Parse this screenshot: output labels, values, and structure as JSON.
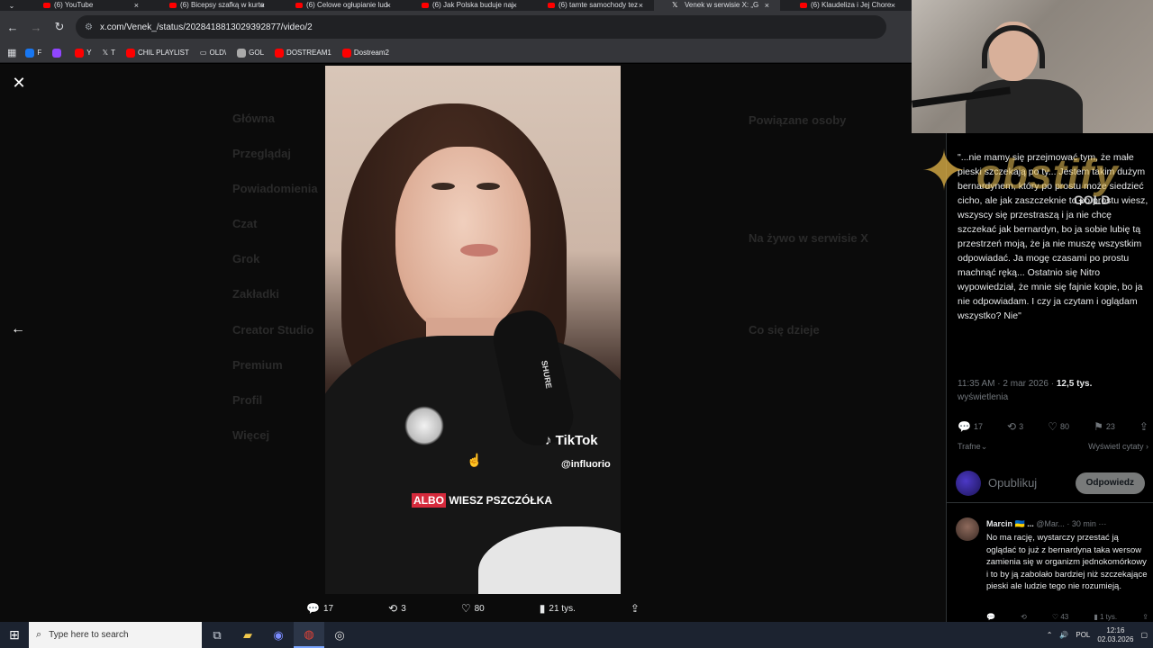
{
  "browser": {
    "tabs": [
      {
        "title": "(6) YouTube",
        "favicon": "youtube-icon"
      },
      {
        "title": "(6) Bicepsy szafką w kurto",
        "favicon": "youtube-icon"
      },
      {
        "title": "(6) Celowe ogłupianie lud",
        "favicon": "youtube-icon"
      },
      {
        "title": "(6) Jak Polska buduje naj",
        "favicon": "youtube-icon"
      },
      {
        "title": "(6) tamte samochody tez",
        "favicon": "youtube-icon"
      },
      {
        "title": "Venek w serwisie X: „G",
        "favicon": "x-icon"
      },
      {
        "title": "(6) Klaudeliza i Jej Chore",
        "favicon": "youtube-icon"
      }
    ],
    "url": "x.com/Venek_/status/2028418813029392877/video/2",
    "bookmarks": [
      "F",
      "",
      "Y",
      "T",
      "CHIL PLAYLIST",
      "OLD\\",
      "GOL",
      "DOSTREAM1",
      "Dostream2"
    ]
  },
  "background_nav": [
    "Główna",
    "Przeglądaj",
    "Powiadomienia",
    "Czat",
    "Grok",
    "Zakładki",
    "Creator Studio",
    "Premium",
    "Profil",
    "Więcej"
  ],
  "background_right": {
    "related": "Powiązane osoby",
    "live": "Na żywo w serwisie X",
    "trending": "Co się dzieje"
  },
  "video": {
    "tiktok_label": "TikTok",
    "tiktok_handle": "@influorio",
    "caption_highlight": "ALBO",
    "caption_rest": " WIESZ PSZCZÓŁKA",
    "mic_brand": "SHURE"
  },
  "media_actions": {
    "replies": "17",
    "reposts": "3",
    "likes": "80",
    "views": "21 tys."
  },
  "tweet": {
    "text": "\"...nie mamy się przejmować tym, że małe pieski szczekają po ty... Jestem takim dużym bernardynem, który po prostu może siedzieć cicho, ale jak zaszczeknie to po prostu wiesz, wszyscy się przestraszą i ja nie chcę szczekać jak bernardyn, bo ja sobie lubię tą przestrzeń moją, że ja nie muszę wszystkim odpowiadać. Ja mogę czasami po prostu machnąć ręką... Ostatnio się Nitro wypowiedział, że mnie się fajnie kopie, bo ja nie odpowiadam. I czy ja czytam i oglądam wszystko? Nie\"",
    "time": "11:35 AM · 2 mar 2026 · ",
    "views_count": "12,5 tys.",
    "views_label": "wyświetlenia",
    "stats": {
      "replies": "17",
      "reposts": "3",
      "likes": "80",
      "bookmarks": "23"
    },
    "sort_label": "Trafne",
    "quotes_label": "Wyświetl cytaty"
  },
  "reply_box": {
    "placeholder": "Opublikuj",
    "button": "Odpowiedz"
  },
  "comment": {
    "name": "Marcin 🇺🇦 ...",
    "handle": "@Mar...",
    "age": "· 30 min",
    "text": "No ma rację, wystarczy przestać ją oglądać to już z bernardyna taka wersow zamienia się w organizm jednokomórkowy i to by ją zabolało bardziej niż szczekające pieski ale ludzie tego nie rozumieją.",
    "stats": {
      "replies": "",
      "reposts": "",
      "likes": "43",
      "views": "1 tys."
    }
  },
  "overlay": {
    "brand": "obstify",
    "tier": "GOLD"
  },
  "taskbar": {
    "search_placeholder": "Type here to search",
    "lang": "POL",
    "time": "12:16",
    "date": "02.03.2026"
  },
  "colors": {
    "accent": "#1d9bf0",
    "tiktok_caption": "#d62a3c",
    "gold": "#f1c75a"
  }
}
